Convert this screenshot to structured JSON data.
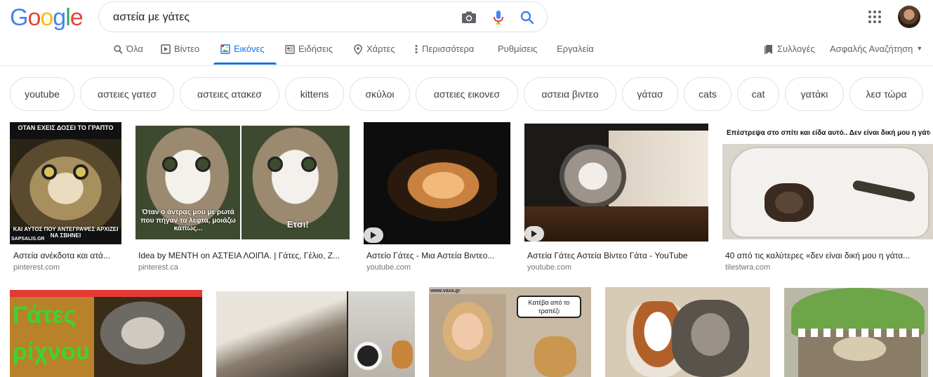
{
  "logo": {
    "letters": [
      "G",
      "o",
      "o",
      "g",
      "l",
      "e"
    ],
    "colors": [
      "#4285F4",
      "#EA4335",
      "#FBBC05",
      "#4285F4",
      "#34A853",
      "#EA4335"
    ]
  },
  "search": {
    "query": "αστεία με γάτες",
    "placeholder": ""
  },
  "tabs": [
    {
      "label": "Όλα",
      "icon": "search-icon"
    },
    {
      "label": "Βίντεο",
      "icon": "video-icon"
    },
    {
      "label": "Εικόνες",
      "icon": "images-icon",
      "active": true
    },
    {
      "label": "Ειδήσεις",
      "icon": "news-icon"
    },
    {
      "label": "Χάρτες",
      "icon": "map-pin-icon"
    },
    {
      "label": "Περισσότερα",
      "icon": "more-vert-icon"
    },
    {
      "label": "Ρυθμίσεις"
    },
    {
      "label": "Εργαλεία"
    }
  ],
  "right_tabs": {
    "collections": "Συλλογές",
    "safe_search": "Ασφαλής Αναζήτηση"
  },
  "chips": [
    "youtube",
    "αστειες γατεσ",
    "αστειες ατακεσ",
    "kittens",
    "σκύλοι",
    "αστειες εικονεσ",
    "αστεια βιντεο",
    "γάτασ",
    "cats",
    "cat",
    "γατάκι",
    "λεσ τώρα"
  ],
  "results": [
    {
      "caption": "Αστεία ανέκδοτα και ατά...",
      "source": "pinterest.com",
      "meme_top": "ΟΤΑΝ ΕΧΕΙΣ ΔΟΣΕΙ ΤΟ ΓΡΑΠΤΟ",
      "meme_bottom": "ΚΑΙ ΑΥΤΟΣ ΠΟΥ ΑΝΤΕΓΡΑΨΕΣ ΑΡΧΙΖΕΙ ΝΑ ΣΒΗΝΕΙ",
      "watermark": "SAPSALIS.GR"
    },
    {
      "caption": "Idea by MENTH on ΑΣΤΕΙΑ ΛΟΙΠΑ. | Γάτες, Γέλιο, Ζ...",
      "source": "pinterest.ca",
      "meme_left": "Όταν ο άντρας μου με ρωτά που πήγαν τα λεφτά, μοιάζω κάπως...",
      "meme_right": "Έτσι!"
    },
    {
      "caption": "Αστείο Γάτες - Μια Αστεία Βιντεο...",
      "source": "youtube.com"
    },
    {
      "caption": "Αστεία Γάτες Αστεία Βίντεο Γάτα - YouTube",
      "source": "youtube.com"
    },
    {
      "caption": "40 από τις καλύτερες «δεν είναι δική μου η γάτα...",
      "source": "tilestwra.com",
      "meme_top": "Επέστρεψα στο σπίτι και είδα αυτό.. Δεν είναι δική μου η γάτα"
    }
  ],
  "row2": {
    "gates_text_1": "Γάτες",
    "gates_text_2": "ρίχνου",
    "speech": "Κατέβα από το τραπέζι",
    "watermark": "www.vaxa.gr"
  },
  "colors": {
    "accent": "#1a73e8",
    "muted": "#5f6368"
  }
}
